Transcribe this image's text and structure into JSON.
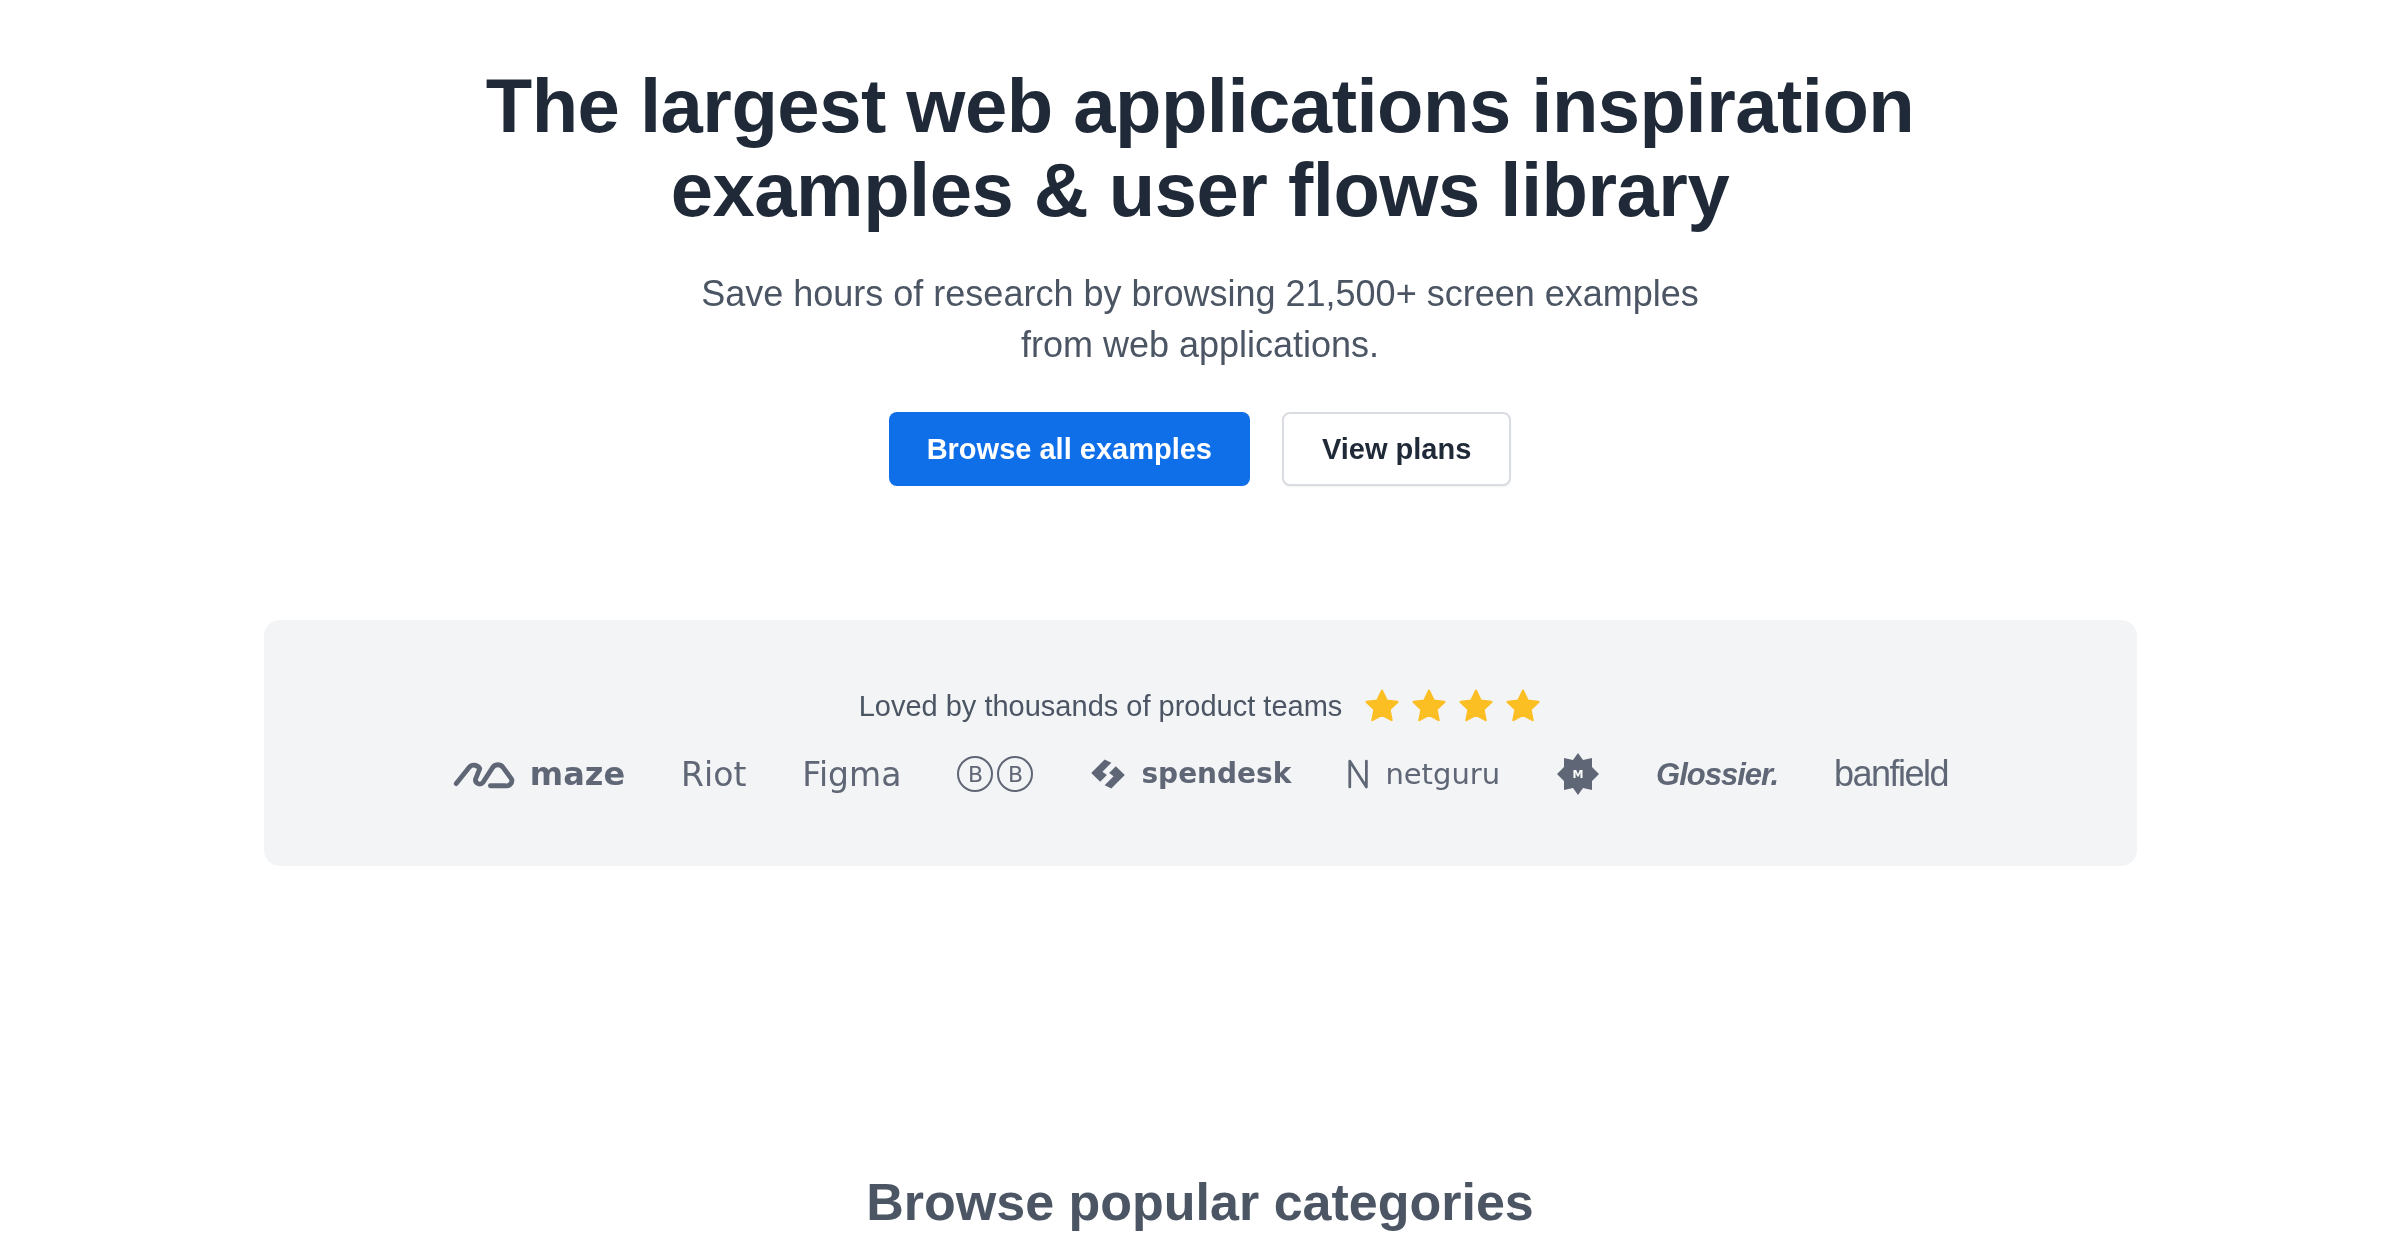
{
  "hero": {
    "title_lines": [
      "The largest web applications inspiration",
      "examples & user flows library"
    ],
    "subtitle_lines": [
      "Save hours of research by browsing 21,500+ screen examples",
      "from web applications."
    ],
    "buttons": [
      {
        "label": "Browse all examples",
        "kind": "primary"
      },
      {
        "label": "View plans",
        "kind": "secondary"
      }
    ]
  },
  "social_proof": {
    "text": "Loved by thousands of product teams",
    "stars": 4,
    "logos": [
      {
        "kind": "maze",
        "text": "maze"
      },
      {
        "kind": "plain",
        "text": "Riot"
      },
      {
        "kind": "plain",
        "text": "Figma"
      },
      {
        "kind": "circled",
        "letters": [
          "B",
          "B"
        ]
      },
      {
        "kind": "spendesk",
        "text": "spendesk"
      },
      {
        "kind": "netguru",
        "text": "netguru"
      },
      {
        "kind": "badge",
        "text": "M"
      },
      {
        "kind": "italic",
        "text": "Glossier."
      },
      {
        "kind": "condensed",
        "text": "banfield"
      }
    ]
  },
  "section_title": "Browse popular categories"
}
